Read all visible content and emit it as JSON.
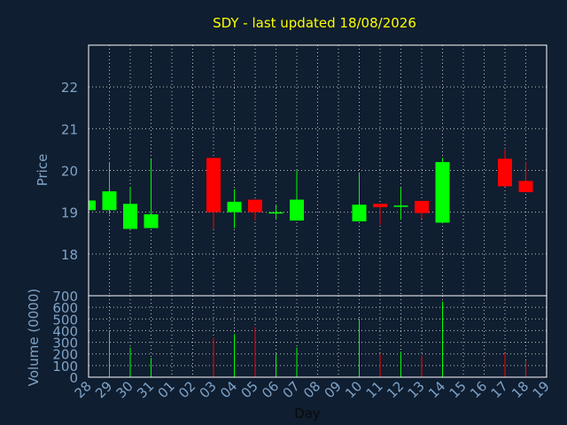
{
  "chart_data": {
    "type": "candlestick",
    "title": "SDY - last updated 18/08/2026",
    "xlabel": "Day",
    "price_panel": {
      "ylabel": "Price",
      "ylim": [
        17.0,
        23.0
      ],
      "yticks": [
        "18",
        "19",
        "20",
        "21",
        "22"
      ],
      "grid": true
    },
    "volume_panel": {
      "ylabel": "Volume (0000)",
      "ylim": [
        0,
        700
      ],
      "yticks": [
        "0",
        "100",
        "200",
        "300",
        "400",
        "500",
        "600",
        "700"
      ],
      "grid": true
    },
    "x_ticks": [
      "28",
      "29",
      "30",
      "31",
      "01",
      "02",
      "03",
      "04",
      "05",
      "06",
      "07",
      "08",
      "09",
      "10",
      "11",
      "12",
      "13",
      "14",
      "15",
      "16",
      "17",
      "18",
      "19"
    ],
    "candles": [
      {
        "day": "28",
        "open": 19.05,
        "high": 19.3,
        "low": 19.05,
        "close": 19.28,
        "volume": 0
      },
      {
        "day": "29",
        "open": 19.05,
        "high": 20.2,
        "low": 18.95,
        "close": 19.5,
        "volume": 400
      },
      {
        "day": "30",
        "open": 18.6,
        "high": 19.6,
        "low": 18.6,
        "close": 19.2,
        "volume": 255
      },
      {
        "day": "31",
        "open": 18.62,
        "high": 20.27,
        "low": 18.62,
        "close": 18.95,
        "volume": 165
      },
      {
        "day": "03",
        "open": 20.3,
        "high": 20.3,
        "low": 18.6,
        "close": 19.0,
        "volume": 340
      },
      {
        "day": "04",
        "open": 19.0,
        "high": 19.55,
        "low": 18.62,
        "close": 19.25,
        "volume": 370
      },
      {
        "day": "05",
        "open": 19.3,
        "high": 19.3,
        "low": 18.8,
        "close": 19.0,
        "volume": 430
      },
      {
        "day": "06",
        "open": 18.98,
        "high": 19.18,
        "low": 18.82,
        "close": 19.0,
        "volume": 200
      },
      {
        "day": "07",
        "open": 18.8,
        "high": 20.0,
        "low": 18.8,
        "close": 19.3,
        "volume": 255
      },
      {
        "day": "10",
        "open": 18.78,
        "high": 19.92,
        "low": 18.78,
        "close": 19.18,
        "volume": 500
      },
      {
        "day": "11",
        "open": 19.2,
        "high": 19.2,
        "low": 18.7,
        "close": 19.12,
        "volume": 200
      },
      {
        "day": "12",
        "open": 19.14,
        "high": 19.58,
        "low": 18.82,
        "close": 19.16,
        "volume": 220
      },
      {
        "day": "13",
        "open": 19.27,
        "high": 19.27,
        "low": 18.85,
        "close": 18.98,
        "volume": 185
      },
      {
        "day": "14",
        "open": 18.75,
        "high": 20.3,
        "low": 18.75,
        "close": 20.2,
        "volume": 650
      },
      {
        "day": "17",
        "open": 20.28,
        "high": 20.5,
        "low": 19.62,
        "close": 19.62,
        "volume": 205
      },
      {
        "day": "18",
        "open": 19.75,
        "high": 20.2,
        "low": 19.48,
        "close": 19.48,
        "volume": 140
      }
    ],
    "colors": {
      "up": "#00ff00",
      "down": "#ff0000",
      "background": "#0f1e30",
      "title": "#ffff00",
      "axis_text": "#7fa3c8",
      "grid": "#c0c0c0",
      "frame": "#ffffff"
    }
  }
}
